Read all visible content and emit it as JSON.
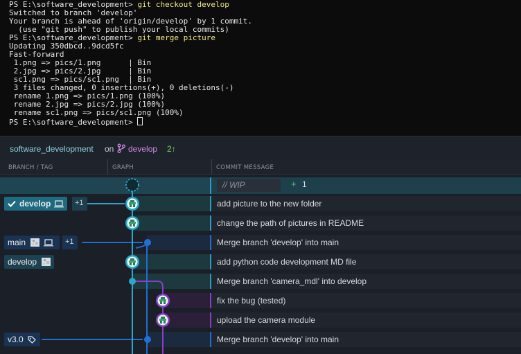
{
  "terminal": {
    "lines": [
      {
        "prompt": "PS E:\\software_development> ",
        "cmd": "git checkout develop"
      },
      {
        "text": "Switched to branch 'develop'"
      },
      {
        "text": "Your branch is ahead of 'origin/develop' by 1 commit."
      },
      {
        "text": "  (use \"git push\" to publish your local commits)"
      },
      {
        "prompt": "PS E:\\software_development> ",
        "cmd": "git merge picture"
      },
      {
        "text": "Updating 350dbcd..9dcd5fc"
      },
      {
        "text": "Fast-forward"
      },
      {
        "text": " 1.png => pics/1.png      | Bin"
      },
      {
        "text": " 2.jpg => pics/2.jpg      | Bin"
      },
      {
        "text": " sc1.png => pics/sc1.png  | Bin"
      },
      {
        "text": " 3 files changed, 0 insertions(+), 0 deletions(-)"
      },
      {
        "text": " rename 1.png => pics/1.png (100%)"
      },
      {
        "text": " rename 2.jpg => pics/2.jpg (100%)"
      },
      {
        "text": " rename sc1.png => pics/sc1.png (100%)"
      },
      {
        "prompt": "PS E:\\software_development> ",
        "cmd": ""
      }
    ]
  },
  "repo": {
    "name": "software_development",
    "on": "on",
    "branch": "develop",
    "ahead": "2↑"
  },
  "columns": {
    "branch_tag": "BRANCH / TAG",
    "graph": "GRAPH",
    "commit_message": "COMMIT MESSAGE"
  },
  "wip": {
    "label": "// WIP",
    "plus": "+",
    "count": "1"
  },
  "refs": {
    "develop_current": "develop",
    "develop_extra": "+1",
    "main": "main",
    "main_extra": "+1",
    "develop_remote": "develop",
    "tag_v30": "v3.0"
  },
  "commits": [
    {
      "message": "add picture to the new folder"
    },
    {
      "message": "change the path of pictures in README"
    },
    {
      "message": "Merge branch 'develop' into main"
    },
    {
      "message": "add python code development MD file"
    },
    {
      "message": "Merge branch 'camera_mdl' into develop"
    },
    {
      "message": "fix the bug (tested)"
    },
    {
      "message": "upload the camera module"
    },
    {
      "message": "Merge branch 'develop' into main"
    }
  ],
  "icons": {
    "branch": "git-branch-icon",
    "check": "check-icon",
    "laptop": "laptop-icon",
    "avatar": "avatar-icon",
    "tag": "tag-icon",
    "commit_avatar": "commit-avatar-icon"
  },
  "colors": {
    "develop": "#2aa7c9",
    "main": "#1f6fd4",
    "camera": "#8a3fc7",
    "terminal_cmd": "#f2e68b",
    "repo_name": "#8fd0de",
    "branch": "#d48ce8",
    "ahead": "#7ad36b"
  }
}
